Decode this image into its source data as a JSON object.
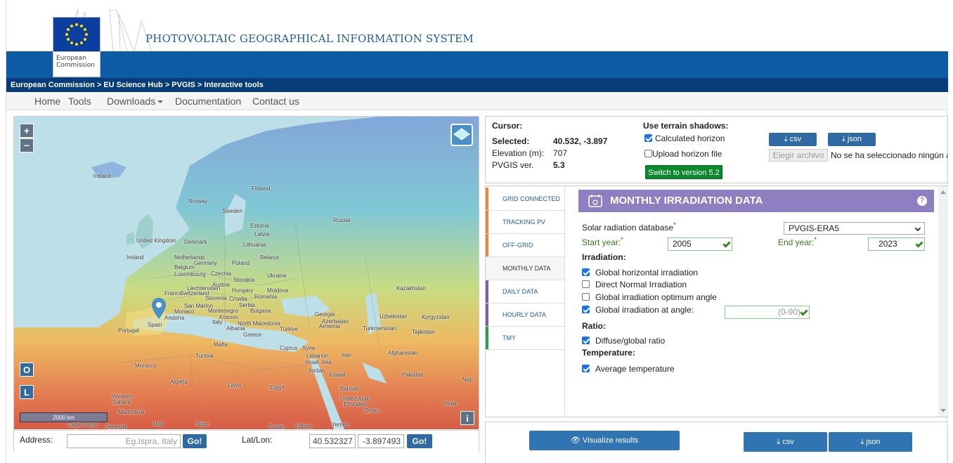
{
  "header": {
    "logo_caption": "European Commission",
    "site_title": "PHOTOVOLTAIC GEOGRAPHICAL INFORMATION SYSTEM",
    "breadcrumb": "European Commission > EU Science Hub > PVGIS > Interactive tools"
  },
  "nav": {
    "home": "Home",
    "tools": "Tools",
    "downloads": "Downloads",
    "documentation": "Documentation",
    "contact": "Contact us"
  },
  "map": {
    "zoom_in": "+",
    "zoom_out": "−",
    "o_button": "O",
    "l_button": "L",
    "info_button": "i",
    "scale": "2000 km",
    "labels": {
      "iceland": "Iceland",
      "finland": "Finland",
      "norway": "Norway",
      "sweden": "Sweden",
      "russia": "Russia",
      "estonia": "Estonia",
      "latvia": "Latvia",
      "lithuania": "Lithuania",
      "uk": "United Kingdom",
      "denmark": "Denmark",
      "ireland": "Ireland",
      "netherlands": "Netherlands",
      "belarus": "Belarus",
      "poland": "Poland",
      "germany": "Germany",
      "belgium": "Belgium",
      "luxembourg": "Luxembourg",
      "czechia": "Czechia",
      "ukraine": "Ukraine",
      "slovakia": "Slovakia",
      "austria": "Austria",
      "liechtenstein": "Liechtenstein",
      "hungary": "Hungary",
      "moldova": "Moldova",
      "france": "France",
      "switzerland": "Switzerland",
      "slovenia": "Slovenia",
      "croatia": "Croatia",
      "romania": "Romania",
      "kazakhstan": "Kazakhstan",
      "san_marino": "San Marino",
      "serbia": "Serbia",
      "monaco": "Monaco",
      "montenegro": "Montenegro",
      "bulgaria": "Bulgaria",
      "andorra": "Andorra",
      "kosovo": "Kosovo",
      "georgia": "Georgia",
      "uzbekistan": "Uzbekistan",
      "kyrgyzstan": "Kyrgyzstan",
      "spain": "Spain",
      "italy": "Italy",
      "north_macedonia": "North Macedonia",
      "azerbaijan": "Azerbaijan",
      "portugal": "Portugal",
      "albania": "Albania",
      "turkiye": "Türkiye",
      "armenia": "Armenia",
      "turkmenistan": "Turkmenistan",
      "tajikistan": "Tajikistan",
      "greece": "Greece",
      "malta": "Malta",
      "cyprus": "Cyprus",
      "syria": "Syria",
      "afghanistan": "Afghanistan",
      "tunisia": "Tunisia",
      "lebanon": "Lebanon",
      "iran": "Iran",
      "israel": "Israel",
      "iraq": "Iraq",
      "morocco": "Morocco",
      "jordan": "Jordan",
      "kuwait": "Kuwait",
      "pakistan": "Pakistan",
      "algeria": "Algeria",
      "libya": "Libya",
      "egypt": "Egypt",
      "bahrain": "Bahrain",
      "nep": "Nep",
      "western_sahara": "Western Sahara",
      "uae": "United Arab Emirates",
      "oman": "Oman",
      "india": "India",
      "mauritania": "Mauritania",
      "cape_verde": "Cape Verde",
      "mali": "Mali",
      "niger": "Niger",
      "senegal": "Senegal",
      "sudan": "Sudan",
      "eritrea": "Eritrea",
      "yemen": "Yemen"
    }
  },
  "address_bar": {
    "address_label": "Address:",
    "address_placeholder": "Eg.Ispra, Italy",
    "go1": "Go!",
    "latlon_label": "Lat/Lon:",
    "lat": "40.532327",
    "lon": "-3.897493",
    "go2": "Go!"
  },
  "info": {
    "cursor_label": "Cursor:",
    "selected_label": "Selected:",
    "selected_value": "40.532, -3.897",
    "elevation_label": "Elevation (m):",
    "elevation_value": "707",
    "pvgis_label": "PVGIS ver.",
    "pvgis_value": "5.3",
    "terrain_title": "Use terrain shadows:",
    "calculated_horizon": "Calculated horizon",
    "upload_horizon": "Upload horizon file",
    "switch_button": "Switch to version 5.2",
    "csv": "csv",
    "json": "json",
    "choose_file": "Elegir archivo",
    "no_file": "No se ha seleccionado ningún archivo"
  },
  "tabs": [
    {
      "label": "GRID CONNECTED",
      "color": "#f0883c"
    },
    {
      "label": "TRACKING PV",
      "color": "#f0883c"
    },
    {
      "label": "OFF-GRID",
      "color": "#f0883c"
    },
    {
      "label": "MONTHLY DATA",
      "color": ""
    },
    {
      "label": "DAILY DATA",
      "color": "#7b5fb0"
    },
    {
      "label": "HOURLY DATA",
      "color": "#7b5fb0"
    },
    {
      "label": "TMY",
      "color": "#2e9e4a"
    }
  ],
  "monthly": {
    "title": "MONTHLY IRRADIATION DATA",
    "help": "?",
    "db_label": "Solar radiation database",
    "db_value": "PVGIS-ERA5",
    "start_label": "Start year:",
    "start_value": "2005",
    "end_label": "End year:",
    "end_value": "2023",
    "irradiation_heading": "Irradiation:",
    "ghi": "Global horizontal irradiation",
    "dni": "Direct Normal Irradiation",
    "optimum": "Global irradiation optimum angle",
    "at_angle": "Global irradiation at angle:",
    "angle_placeholder": "(0-90)",
    "ratio_heading": "Ratio:",
    "diffuse": "Diffuse/global ratio",
    "temp_heading": "Temperature:",
    "avg_temp": "Average temperature"
  },
  "bottom": {
    "visualize": "Visualize results",
    "csv": "csv",
    "json": "json"
  }
}
